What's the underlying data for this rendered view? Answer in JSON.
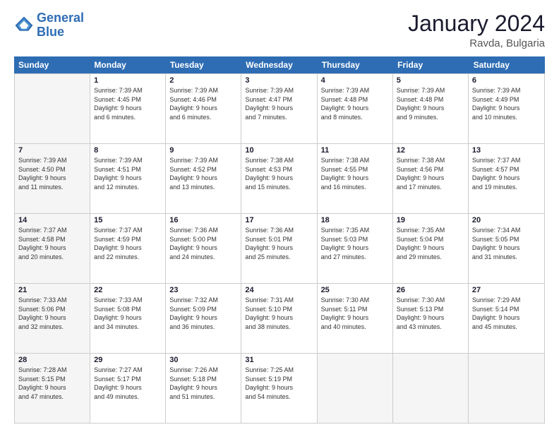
{
  "logo": {
    "line1": "General",
    "line2": "Blue"
  },
  "header": {
    "month": "January 2024",
    "location": "Ravda, Bulgaria"
  },
  "weekdays": [
    "Sunday",
    "Monday",
    "Tuesday",
    "Wednesday",
    "Thursday",
    "Friday",
    "Saturday"
  ],
  "rows": [
    [
      {
        "num": "",
        "lines": [],
        "empty": true
      },
      {
        "num": "1",
        "lines": [
          "Sunrise: 7:39 AM",
          "Sunset: 4:45 PM",
          "Daylight: 9 hours",
          "and 6 minutes."
        ]
      },
      {
        "num": "2",
        "lines": [
          "Sunrise: 7:39 AM",
          "Sunset: 4:46 PM",
          "Daylight: 9 hours",
          "and 6 minutes."
        ]
      },
      {
        "num": "3",
        "lines": [
          "Sunrise: 7:39 AM",
          "Sunset: 4:47 PM",
          "Daylight: 9 hours",
          "and 7 minutes."
        ]
      },
      {
        "num": "4",
        "lines": [
          "Sunrise: 7:39 AM",
          "Sunset: 4:48 PM",
          "Daylight: 9 hours",
          "and 8 minutes."
        ]
      },
      {
        "num": "5",
        "lines": [
          "Sunrise: 7:39 AM",
          "Sunset: 4:48 PM",
          "Daylight: 9 hours",
          "and 9 minutes."
        ]
      },
      {
        "num": "6",
        "lines": [
          "Sunrise: 7:39 AM",
          "Sunset: 4:49 PM",
          "Daylight: 9 hours",
          "and 10 minutes."
        ]
      }
    ],
    [
      {
        "num": "7",
        "lines": [
          "Sunrise: 7:39 AM",
          "Sunset: 4:50 PM",
          "Daylight: 9 hours",
          "and 11 minutes."
        ],
        "shaded": true
      },
      {
        "num": "8",
        "lines": [
          "Sunrise: 7:39 AM",
          "Sunset: 4:51 PM",
          "Daylight: 9 hours",
          "and 12 minutes."
        ]
      },
      {
        "num": "9",
        "lines": [
          "Sunrise: 7:39 AM",
          "Sunset: 4:52 PM",
          "Daylight: 9 hours",
          "and 13 minutes."
        ]
      },
      {
        "num": "10",
        "lines": [
          "Sunrise: 7:38 AM",
          "Sunset: 4:53 PM",
          "Daylight: 9 hours",
          "and 15 minutes."
        ]
      },
      {
        "num": "11",
        "lines": [
          "Sunrise: 7:38 AM",
          "Sunset: 4:55 PM",
          "Daylight: 9 hours",
          "and 16 minutes."
        ]
      },
      {
        "num": "12",
        "lines": [
          "Sunrise: 7:38 AM",
          "Sunset: 4:56 PM",
          "Daylight: 9 hours",
          "and 17 minutes."
        ]
      },
      {
        "num": "13",
        "lines": [
          "Sunrise: 7:37 AM",
          "Sunset: 4:57 PM",
          "Daylight: 9 hours",
          "and 19 minutes."
        ]
      }
    ],
    [
      {
        "num": "14",
        "lines": [
          "Sunrise: 7:37 AM",
          "Sunset: 4:58 PM",
          "Daylight: 9 hours",
          "and 20 minutes."
        ],
        "shaded": true
      },
      {
        "num": "15",
        "lines": [
          "Sunrise: 7:37 AM",
          "Sunset: 4:59 PM",
          "Daylight: 9 hours",
          "and 22 minutes."
        ]
      },
      {
        "num": "16",
        "lines": [
          "Sunrise: 7:36 AM",
          "Sunset: 5:00 PM",
          "Daylight: 9 hours",
          "and 24 minutes."
        ]
      },
      {
        "num": "17",
        "lines": [
          "Sunrise: 7:36 AM",
          "Sunset: 5:01 PM",
          "Daylight: 9 hours",
          "and 25 minutes."
        ]
      },
      {
        "num": "18",
        "lines": [
          "Sunrise: 7:35 AM",
          "Sunset: 5:03 PM",
          "Daylight: 9 hours",
          "and 27 minutes."
        ]
      },
      {
        "num": "19",
        "lines": [
          "Sunrise: 7:35 AM",
          "Sunset: 5:04 PM",
          "Daylight: 9 hours",
          "and 29 minutes."
        ]
      },
      {
        "num": "20",
        "lines": [
          "Sunrise: 7:34 AM",
          "Sunset: 5:05 PM",
          "Daylight: 9 hours",
          "and 31 minutes."
        ]
      }
    ],
    [
      {
        "num": "21",
        "lines": [
          "Sunrise: 7:33 AM",
          "Sunset: 5:06 PM",
          "Daylight: 9 hours",
          "and 32 minutes."
        ],
        "shaded": true
      },
      {
        "num": "22",
        "lines": [
          "Sunrise: 7:33 AM",
          "Sunset: 5:08 PM",
          "Daylight: 9 hours",
          "and 34 minutes."
        ]
      },
      {
        "num": "23",
        "lines": [
          "Sunrise: 7:32 AM",
          "Sunset: 5:09 PM",
          "Daylight: 9 hours",
          "and 36 minutes."
        ]
      },
      {
        "num": "24",
        "lines": [
          "Sunrise: 7:31 AM",
          "Sunset: 5:10 PM",
          "Daylight: 9 hours",
          "and 38 minutes."
        ]
      },
      {
        "num": "25",
        "lines": [
          "Sunrise: 7:30 AM",
          "Sunset: 5:11 PM",
          "Daylight: 9 hours",
          "and 40 minutes."
        ]
      },
      {
        "num": "26",
        "lines": [
          "Sunrise: 7:30 AM",
          "Sunset: 5:13 PM",
          "Daylight: 9 hours",
          "and 43 minutes."
        ]
      },
      {
        "num": "27",
        "lines": [
          "Sunrise: 7:29 AM",
          "Sunset: 5:14 PM",
          "Daylight: 9 hours",
          "and 45 minutes."
        ]
      }
    ],
    [
      {
        "num": "28",
        "lines": [
          "Sunrise: 7:28 AM",
          "Sunset: 5:15 PM",
          "Daylight: 9 hours",
          "and 47 minutes."
        ],
        "shaded": true
      },
      {
        "num": "29",
        "lines": [
          "Sunrise: 7:27 AM",
          "Sunset: 5:17 PM",
          "Daylight: 9 hours",
          "and 49 minutes."
        ]
      },
      {
        "num": "30",
        "lines": [
          "Sunrise: 7:26 AM",
          "Sunset: 5:18 PM",
          "Daylight: 9 hours",
          "and 51 minutes."
        ]
      },
      {
        "num": "31",
        "lines": [
          "Sunrise: 7:25 AM",
          "Sunset: 5:19 PM",
          "Daylight: 9 hours",
          "and 54 minutes."
        ]
      },
      {
        "num": "",
        "lines": [],
        "empty": true
      },
      {
        "num": "",
        "lines": [],
        "empty": true
      },
      {
        "num": "",
        "lines": [],
        "empty": true
      }
    ]
  ]
}
